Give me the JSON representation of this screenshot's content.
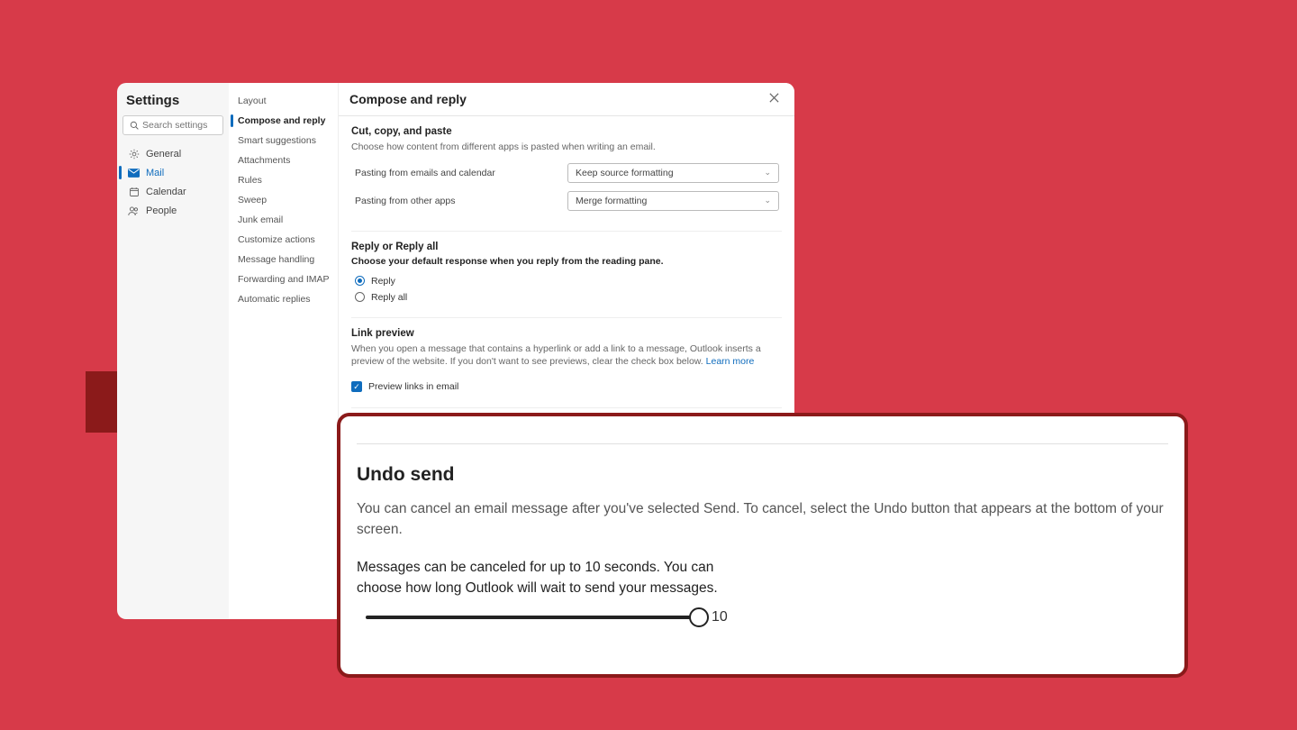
{
  "window": {
    "title": "Settings",
    "search_placeholder": "Search settings"
  },
  "nav": {
    "general": "General",
    "mail": "Mail",
    "calendar": "Calendar",
    "people": "People"
  },
  "subnav": {
    "layout": "Layout",
    "compose": "Compose and reply",
    "smart": "Smart suggestions",
    "attachments": "Attachments",
    "rules": "Rules",
    "sweep": "Sweep",
    "junk": "Junk email",
    "customize": "Customize actions",
    "handling": "Message handling",
    "forwarding": "Forwarding and IMAP",
    "autoreply": "Automatic replies"
  },
  "content": {
    "title": "Compose and reply",
    "cut": {
      "title": "Cut, copy, and paste",
      "desc": "Choose how content from different apps is pasted when writing an email.",
      "row1_label": "Pasting from emails and calendar",
      "row1_value": "Keep source formatting",
      "row2_label": "Pasting from other apps",
      "row2_value": "Merge formatting"
    },
    "reply": {
      "title": "Reply or Reply all",
      "desc": "Choose your default response when you reply from the reading pane.",
      "opt1": "Reply",
      "opt2": "Reply all"
    },
    "link": {
      "title": "Link preview",
      "desc": "When you open a message that contains a hyperlink or add a link to a message, Outlook inserts a preview of the website. If you don't want to see previews, clear the check box below. ",
      "learn": "Learn more",
      "check_label": "Preview links in email"
    },
    "undo": {
      "title": "Undo send"
    }
  },
  "zoom": {
    "title": "Undo send",
    "desc": "You can cancel an email message after you've selected Send. To cancel, select the Undo button that appears at the bottom of your screen.",
    "note": "Messages can be canceled for up to 10 seconds. You can choose how long Outlook will wait to send your messages.",
    "value": "10"
  }
}
